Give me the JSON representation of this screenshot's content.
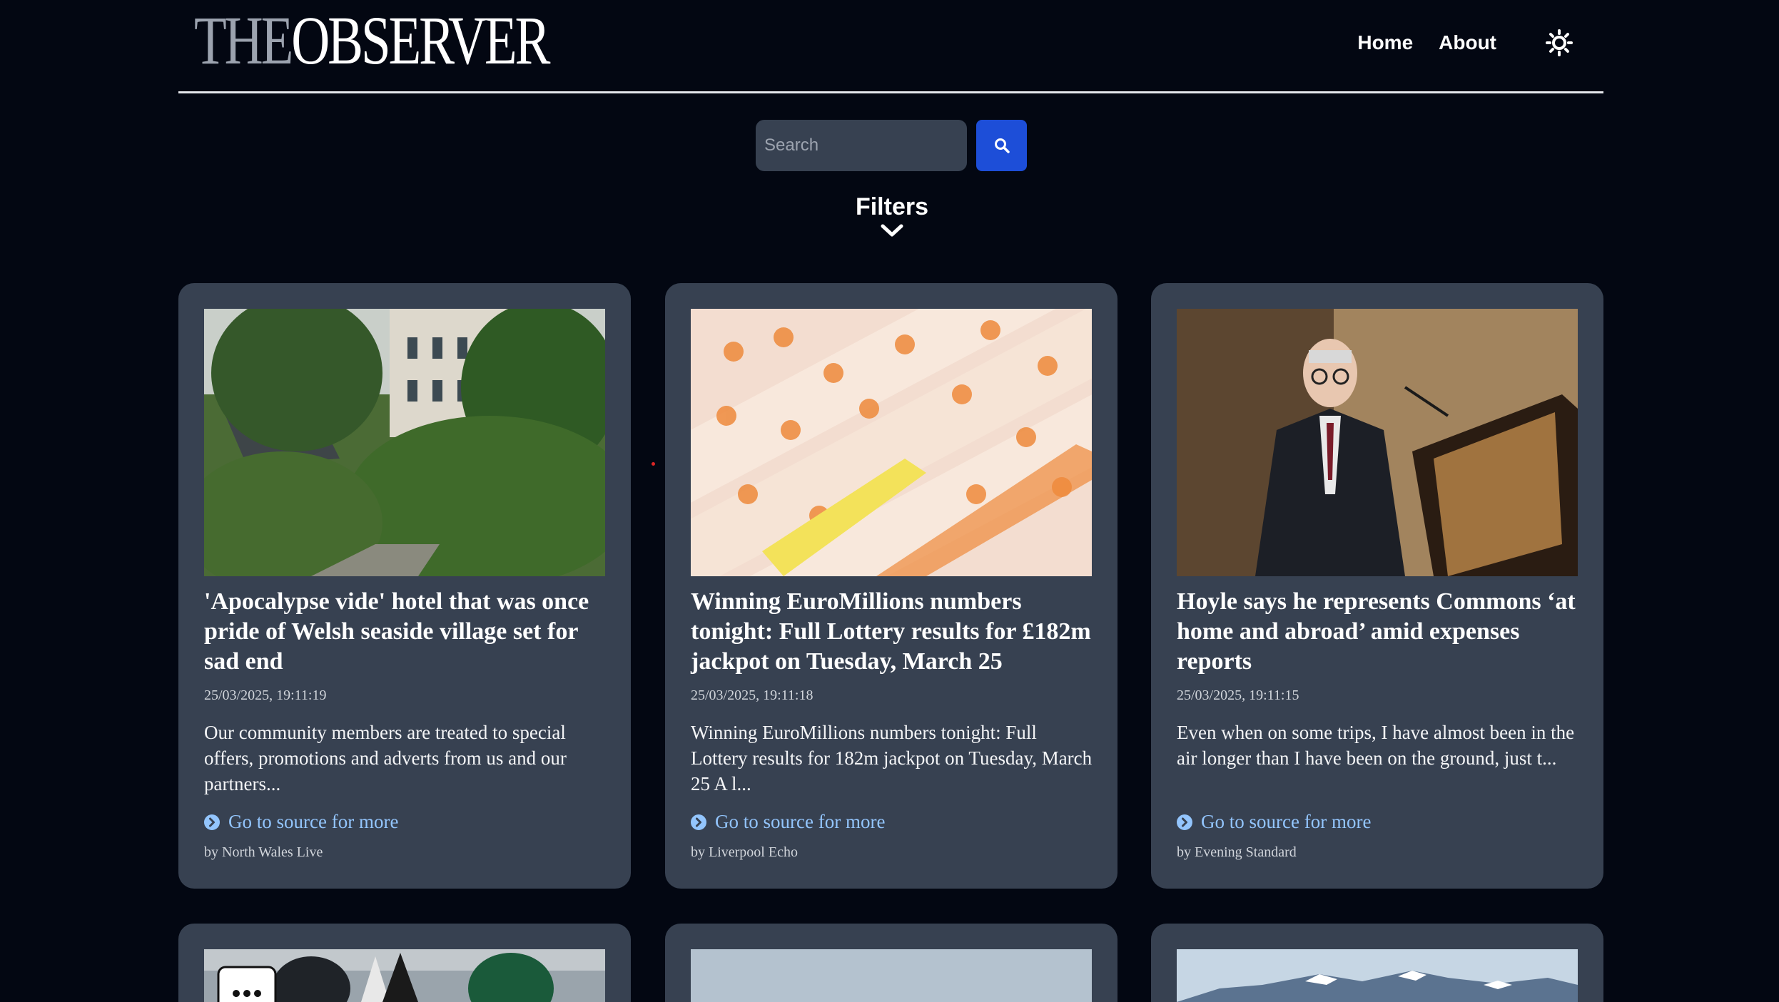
{
  "header": {
    "logo_the": "THE",
    "logo_observer": "OBSERVER",
    "nav": [
      {
        "label": "Home"
      },
      {
        "label": "About"
      }
    ],
    "theme_icon": "sun-icon"
  },
  "search": {
    "placeholder": "Search",
    "value": "",
    "button_icon": "search-icon"
  },
  "filters": {
    "label": "Filters",
    "icon": "chevron-down-icon"
  },
  "articles": [
    {
      "title": "'Apocalypse vide' hotel that was once pride of Welsh seaside village set for sad end",
      "date": "25/03/2025, 19:11:19",
      "description": "Our community members are treated to special offers, promotions and adverts from us and our partners...",
      "link_label": "Go to source for more",
      "byline": "by North Wales Live",
      "image": "overgrown-hotel-photo"
    },
    {
      "title": "Winning EuroMillions numbers tonight: Full Lottery results for £182m jackpot on Tuesday, March 25",
      "date": "25/03/2025, 19:11:18",
      "description": "Winning EuroMillions numbers tonight: Full Lottery results for 182m jackpot on Tuesday, March 25 A l...",
      "link_label": "Go to source for more",
      "byline": "by Liverpool Echo",
      "image": "lottery-tickets-photo"
    },
    {
      "title": "Hoyle says he represents Commons ‘at home and abroad’ amid expenses reports",
      "date": "25/03/2025, 19:11:15",
      "description": "Even when on some trips, I have almost been in the air longer than I have been on the ground, just t...",
      "link_label": "Go to source for more",
      "byline": "by Evening Standard",
      "image": "speaker-at-podium-photo"
    },
    {
      "image": "football-helmets-photo"
    },
    {
      "image": "sky-photo"
    },
    {
      "image": "snowy-mountains-photo"
    }
  ],
  "colors": {
    "background": "#030712",
    "card": "#374151",
    "accent": "#1d4ed8",
    "link": "#93c5fd"
  }
}
